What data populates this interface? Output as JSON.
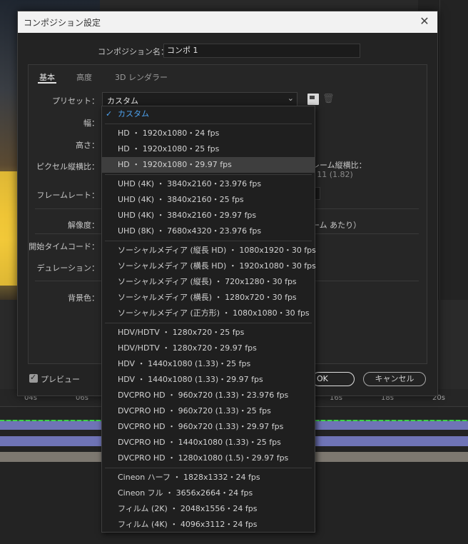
{
  "dialog": {
    "title": "コンポジション設定",
    "close_glyph": "✕",
    "name_label": "コンポジション名：",
    "name_value": "コンポ 1",
    "tabs": [
      "基本",
      "高度",
      "3D レンダラー"
    ],
    "labels": {
      "preset": "プリセット：",
      "width": "幅：",
      "height": "高さ：",
      "pixel_aspect": "ピクセル縦横比：",
      "frame_rate": "フレームレート：",
      "resolution": "解像度：",
      "start_timecode": "開始タイムコード：",
      "duration": "デュレーション：",
      "bg_color": "背景色："
    },
    "preset_value": "カスタム",
    "frame_aspect_label": "レーム縦横比：",
    "frame_aspect_value": ": 11 (1.82)",
    "per_frame_text": "ーム あたり）",
    "preview_label": "プレビュー",
    "ok_label": "OK",
    "cancel_label": "キャンセル"
  },
  "dropdown": {
    "checked": "カスタム",
    "groups": [
      [
        "HD ・ 1920x1080・24 fps",
        "HD ・ 1920x1080・25 fps",
        "HD ・ 1920x1080・29.97 fps"
      ],
      [
        "UHD (4K) ・ 3840x2160・23.976 fps",
        "UHD (4K) ・ 3840x2160・25 fps",
        "UHD (4K) ・ 3840x2160・29.97 fps",
        "UHD (8K) ・ 7680x4320・23.976 fps"
      ],
      [
        "ソーシャルメディア (縦長 HD) ・ 1080x1920・30 fps",
        "ソーシャルメディア (横長 HD) ・ 1920x1080・30 fps",
        "ソーシャルメディア (縦長) ・ 720x1280・30 fps",
        "ソーシャルメディア (横長) ・ 1280x720・30 fps",
        "ソーシャルメディア (正方形) ・ 1080x1080・30 fps"
      ],
      [
        "HDV/HDTV ・ 1280x720・25 fps",
        "HDV/HDTV ・ 1280x720・29.97 fps",
        "HDV ・ 1440x1080 (1.33)・25 fps",
        "HDV ・ 1440x1080 (1.33)・29.97 fps",
        "DVCPRO HD ・ 960x720 (1.33)・23.976 fps",
        "DVCPRO HD ・ 960x720 (1.33)・25 fps",
        "DVCPRO HD ・ 960x720 (1.33)・29.97 fps",
        "DVCPRO HD ・ 1440x1080 (1.33)・25 fps",
        "DVCPRO HD ・ 1280x1080 (1.5)・29.97 fps"
      ],
      [
        "Cineon ハーフ ・ 1828x1332・24 fps",
        "Cineon フル ・ 3656x2664・24 fps",
        "フィルム (2K) ・ 2048x1556・24 fps",
        "フィルム (4K) ・ 4096x3112・24 fps"
      ]
    ],
    "highlighted": "HD ・ 1920x1080・29.97 fps"
  },
  "timeline": {
    "ticks": [
      "04s",
      "06s",
      "16s",
      "18s",
      "20s"
    ]
  },
  "colors": {
    "accent": "#4ea3f0",
    "clip_blue": "#6f74b6",
    "clip_gray": "#7d7870"
  }
}
